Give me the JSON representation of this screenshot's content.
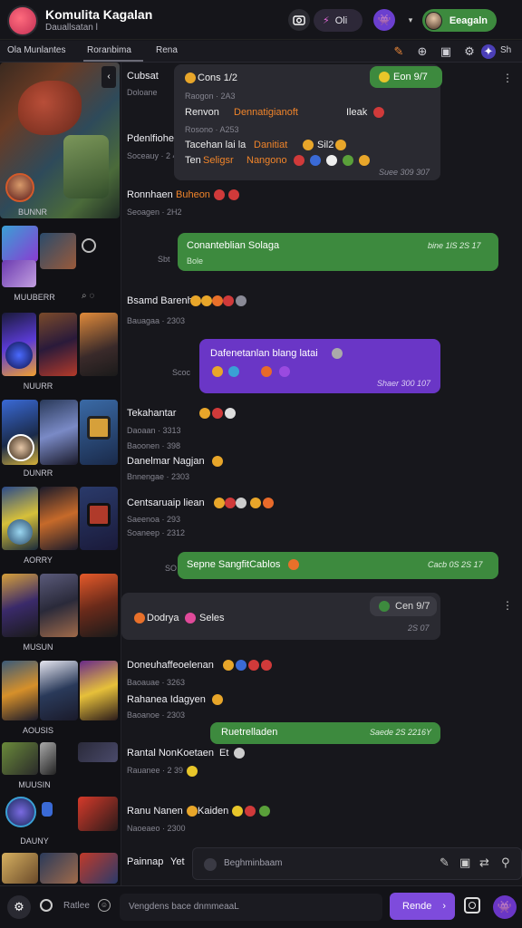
{
  "header": {
    "title": "Komulita Kagalan",
    "subtitle": "Dauallsatan l",
    "pill_label": "Oli",
    "user_label": "Eeagaln"
  },
  "tabs": [
    "Ola Munlantes",
    "Roranbima",
    "Rena"
  ],
  "tab_icons": [
    "pencil-icon",
    "gamepad-icon",
    "image-icon",
    "gear-icon",
    "star-icon"
  ],
  "tab_icon_extra": "Sh",
  "sidebar": {
    "labels": [
      "BUNNR",
      "MUUBERR",
      "NUURR",
      "DUNRR",
      "AORRY",
      "MUSUN",
      "AOUSIS",
      "MUUSIN",
      "DAUNY"
    ]
  },
  "messages": [
    {
      "name": "Cubsat",
      "meta": "Doloane"
    },
    {
      "name": "Pdenlfiohe",
      "meta": "Soceauy · 2 4"
    },
    {
      "name": "Ronnhaen",
      "name2": "Buheon",
      "meta": "Seoagen · 2H2"
    },
    {
      "name": "Bsamd Barenh",
      "meta": "Bauagaa · 2303"
    },
    {
      "name": "Tekahantar",
      "meta": "Daoaan · 3313",
      "meta2": "Baoonen · 398",
      "name2": "Danelmar Nagjan",
      "meta3": "Bnnengae · 2303"
    },
    {
      "name": "Centsaruaip liean",
      "meta": "Saeenoa · 293",
      "meta2": "Soaneep · 2312"
    },
    {
      "name": "Doneuhaffeoelenan",
      "meta": "Baoauae · 3263",
      "name2": "Rahanea Idagyen",
      "meta2": "Baoanoe · 2303"
    },
    {
      "name": "Rantal NonKoetaen",
      "name_b": "Et",
      "meta": "Rauanee · 2 39"
    },
    {
      "name": "Ranu Nanen",
      "name_b": "Kaiden",
      "meta": "Naoeaeo · 2300"
    },
    {
      "name": "Painnap",
      "name_b": "Yet"
    }
  ],
  "bubbles": {
    "top_card": {
      "tag": "Cons 1/2",
      "badge": "Eon 9/7",
      "line1": "Raogon · 2A3",
      "line2a": "Renvon",
      "line2b": "Dennatigianoft",
      "line2c": "Ileak",
      "line3": "Rosono · A253",
      "line4a": "Tacehan lai la",
      "line4b": "Danitiat",
      "line4c": "Sil2",
      "line5a": "Ten",
      "line5b": "Seligsr",
      "line5c": "Nangono",
      "time": "Suee 309 307"
    },
    "green1": {
      "text": "Conanteblian Solaga",
      "sub": "Bole",
      "time": "bine 1lS 2S 17",
      "side": "Sbt"
    },
    "purple1": {
      "text": "Dafenetanlan blang latai",
      "time": "Shaer 300 107",
      "side": "Scoc"
    },
    "green2": {
      "text": "Sepne SangfitCablos",
      "time": "Cacb 0S 2S 17",
      "side": "SO"
    },
    "grey_card": {
      "badge": "Cen 9/7",
      "text_a": "Dodrya",
      "text_b": "Seles",
      "time": "2S 07"
    },
    "green3": {
      "text": "Ruetrelladen",
      "time": "Saede 2S 2216Y"
    }
  },
  "composer": {
    "left_label": "Ratlee",
    "placeholder": "Vengdens bace dnmmeaaL",
    "send_label": "Rende",
    "search_label": "Beghminbaam"
  },
  "colors": {
    "green": "#3d8a3e",
    "purple": "#6a36c6",
    "accent": "#7e4bdc",
    "orange": "#f0842a"
  }
}
